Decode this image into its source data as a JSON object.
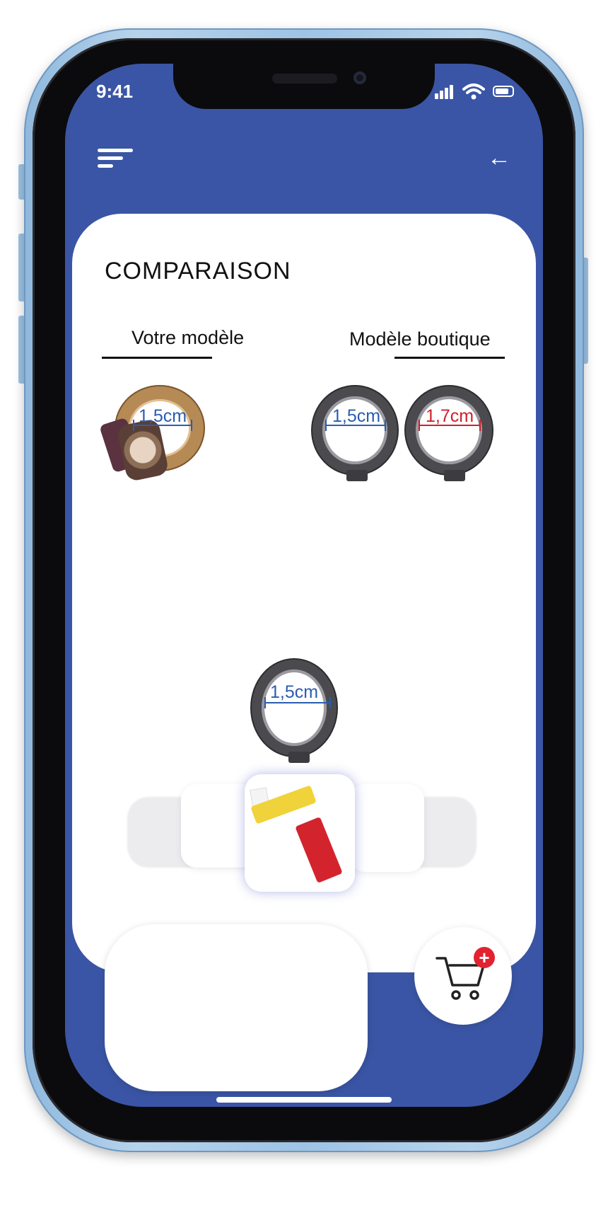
{
  "status_bar": {
    "time": "9:41"
  },
  "header": {
    "menu_icon": "menu-icon",
    "back_icon": "arrow-left-icon"
  },
  "comparison": {
    "title": "COMPARAISON",
    "your_model_label": "Votre modèle",
    "shop_model_label": "Modèle boutique",
    "your_model": {
      "measure": "1,5cm",
      "measure_color": "#2a5db0"
    },
    "shop_models": [
      {
        "measure": "1,5cm",
        "measure_color": "#2a5db0"
      },
      {
        "measure": "1,7cm",
        "measure_color": "#d0202a"
      }
    ]
  },
  "preview": {
    "measure": "1,5cm",
    "measure_color": "#2a5db0"
  },
  "carousel": {
    "selected_icon": "measuring-tape-icon"
  },
  "cart": {
    "icon": "shopping-cart-icon",
    "badge": "+",
    "badge_color": "#e3222f"
  },
  "colors": {
    "primary": "#3a55a5",
    "card": "#ffffff"
  }
}
